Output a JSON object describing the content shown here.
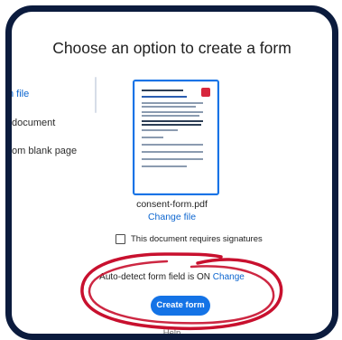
{
  "dialog": {
    "title": "Choose an option to create a form"
  },
  "sidebar": {
    "items": [
      {
        "label": "n file"
      },
      {
        "label": "document"
      },
      {
        "label": "om blank page"
      }
    ]
  },
  "file": {
    "name": "consent-form.pdf",
    "change_label": "Change file"
  },
  "signature": {
    "label": "This document requires signatures",
    "checked": false
  },
  "auto_detect": {
    "text": "Auto-detect form field is ON",
    "link": "Change"
  },
  "actions": {
    "create_label": "Create form",
    "help_label": "Help"
  },
  "colors": {
    "accent": "#1473e6",
    "frame": "#0b1b3d",
    "annotation": "#c8102e"
  }
}
